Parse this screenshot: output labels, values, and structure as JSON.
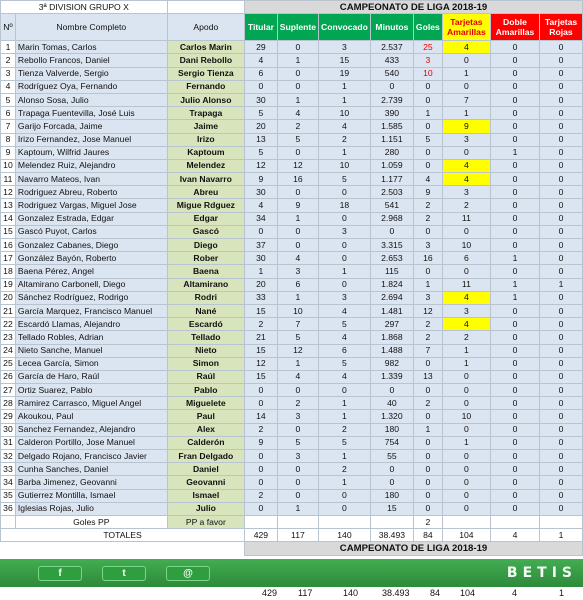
{
  "header": {
    "division": "3ª DIVISION  GRUPO X",
    "campeonato": "CAMPEONATO  DE LIGA 2018-19",
    "col_n": "Nº",
    "col_nombre": "Nombre Completo",
    "col_apodo": "Apodo",
    "col_titular": "Titular",
    "col_suplente": "Suplente",
    "col_convocado": "Convocado",
    "col_minutos": "Minutos",
    "col_goles": "Goles",
    "col_amarillas": "Tarjetas Amarillas",
    "col_doble": "Doble Amarillas",
    "col_rojas": "Tarjetas Rojas"
  },
  "players": [
    {
      "n": "1",
      "nombre": "Marin Tomas, Carlos",
      "apodo": "Carlos Marin",
      "titular": "29",
      "suplente": "0",
      "convocado": "3",
      "minutos": "2.537",
      "goles": "25",
      "amarillas": "4",
      "doble": "0",
      "rojas": "0"
    },
    {
      "n": "2",
      "nombre": "Rebollo Francos, Daniel",
      "apodo": "Dani Rebollo",
      "titular": "4",
      "suplente": "1",
      "convocado": "15",
      "minutos": "433",
      "goles": "3",
      "amarillas": "0",
      "doble": "0",
      "rojas": "0"
    },
    {
      "n": "3",
      "nombre": "Tienza Valverde, Sergio",
      "apodo": "Sergio Tienza",
      "titular": "6",
      "suplente": "0",
      "convocado": "19",
      "minutos": "540",
      "goles": "10",
      "amarillas": "1",
      "doble": "0",
      "rojas": "0"
    },
    {
      "n": "4",
      "nombre": "Rodríguez Oya, Fernando",
      "apodo": "Fernando",
      "titular": "0",
      "suplente": "0",
      "convocado": "1",
      "minutos": "0",
      "goles": "0",
      "amarillas": "0",
      "doble": "0",
      "rojas": "0"
    },
    {
      "n": "5",
      "nombre": "Alonso Sosa, Julio",
      "apodo": "Julio Alonso",
      "titular": "30",
      "suplente": "1",
      "convocado": "1",
      "minutos": "2.739",
      "goles": "0",
      "amarillas": "7",
      "doble": "0",
      "rojas": "0"
    },
    {
      "n": "6",
      "nombre": "Trapaga Fuentevilla, José Luis",
      "apodo": "Trapaga",
      "titular": "5",
      "suplente": "4",
      "convocado": "10",
      "minutos": "390",
      "goles": "1",
      "amarillas": "1",
      "doble": "0",
      "rojas": "0"
    },
    {
      "n": "7",
      "nombre": "Garijo Forcada, Jaime",
      "apodo": "Jaime",
      "titular": "20",
      "suplente": "2",
      "convocado": "4",
      "minutos": "1.585",
      "goles": "0",
      "amarillas": "9",
      "doble": "0",
      "rojas": "0"
    },
    {
      "n": "8",
      "nombre": "Irizo Fernandez, Jose Manuel",
      "apodo": "Irizo",
      "titular": "13",
      "suplente": "5",
      "convocado": "2",
      "minutos": "1.151",
      "goles": "5",
      "amarillas": "3",
      "doble": "0",
      "rojas": "0"
    },
    {
      "n": "9",
      "nombre": "Kaptoum, Wilfrid Jaures",
      "apodo": "Kaptoum",
      "titular": "5",
      "suplente": "0",
      "convocado": "1",
      "minutos": "280",
      "goles": "0",
      "amarillas": "0",
      "doble": "1",
      "rojas": "0"
    },
    {
      "n": "10",
      "nombre": "Melendez Ruiz, Alejandro",
      "apodo": "Melendez",
      "titular": "12",
      "suplente": "12",
      "convocado": "10",
      "minutos": "1.059",
      "goles": "0",
      "amarillas": "4",
      "doble": "0",
      "rojas": "0"
    },
    {
      "n": "11",
      "nombre": "Navarro Mateos, Ivan",
      "apodo": "Ivan Navarro",
      "titular": "9",
      "suplente": "16",
      "convocado": "5",
      "minutos": "1.177",
      "goles": "4",
      "amarillas": "4",
      "doble": "0",
      "rojas": "0"
    },
    {
      "n": "12",
      "nombre": "Rodriguez Abreu, Roberto",
      "apodo": "Abreu",
      "titular": "30",
      "suplente": "0",
      "convocado": "0",
      "minutos": "2.503",
      "goles": "9",
      "amarillas": "3",
      "doble": "0",
      "rojas": "0"
    },
    {
      "n": "13",
      "nombre": "Rodriguez Vargas, Miguel Jose",
      "apodo": "Migue Rdguez",
      "titular": "4",
      "suplente": "9",
      "convocado": "18",
      "minutos": "541",
      "goles": "2",
      "amarillas": "2",
      "doble": "0",
      "rojas": "0"
    },
    {
      "n": "14",
      "nombre": "Gonzalez Estrada, Edgar",
      "apodo": "Edgar",
      "titular": "34",
      "suplente": "1",
      "convocado": "0",
      "minutos": "2.968",
      "goles": "2",
      "amarillas": "11",
      "doble": "0",
      "rojas": "0"
    },
    {
      "n": "15",
      "nombre": "Gascó Puyot, Carlos",
      "apodo": "Gascó",
      "titular": "0",
      "suplente": "0",
      "convocado": "3",
      "minutos": "0",
      "goles": "0",
      "amarillas": "0",
      "doble": "0",
      "rojas": "0"
    },
    {
      "n": "16",
      "nombre": "Gonzalez Cabanes, Diego",
      "apodo": "Diego",
      "titular": "37",
      "suplente": "0",
      "convocado": "0",
      "minutos": "3.315",
      "goles": "3",
      "amarillas": "10",
      "doble": "0",
      "rojas": "0"
    },
    {
      "n": "17",
      "nombre": "González Bayón, Roberto",
      "apodo": "Rober",
      "titular": "30",
      "suplente": "4",
      "convocado": "0",
      "minutos": "2.653",
      "goles": "16",
      "amarillas": "6",
      "doble": "1",
      "rojas": "0"
    },
    {
      "n": "18",
      "nombre": "Baena Pérez, Angel",
      "apodo": "Baena",
      "titular": "1",
      "suplente": "3",
      "convocado": "1",
      "minutos": "115",
      "goles": "0",
      "amarillas": "0",
      "doble": "0",
      "rojas": "0"
    },
    {
      "n": "19",
      "nombre": "Altamirano Carbonell, Diego",
      "apodo": "Altamirano",
      "titular": "20",
      "suplente": "6",
      "convocado": "0",
      "minutos": "1.824",
      "goles": "1",
      "amarillas": "11",
      "doble": "1",
      "rojas": "1"
    },
    {
      "n": "20",
      "nombre": "Sánchez Rodríguez, Rodrigo",
      "apodo": "Rodri",
      "titular": "33",
      "suplente": "1",
      "convocado": "3",
      "minutos": "2.694",
      "goles": "3",
      "amarillas": "4",
      "doble": "1",
      "rojas": "0"
    },
    {
      "n": "21",
      "nombre": "García Marquez, Francisco Manuel",
      "apodo": "Nané",
      "titular": "15",
      "suplente": "10",
      "convocado": "4",
      "minutos": "1.481",
      "goles": "12",
      "amarillas": "3",
      "doble": "0",
      "rojas": "0"
    },
    {
      "n": "22",
      "nombre": "Escardó Llamas, Alejandro",
      "apodo": "Escardó",
      "titular": "2",
      "suplente": "7",
      "convocado": "5",
      "minutos": "297",
      "goles": "2",
      "amarillas": "4",
      "doble": "0",
      "rojas": "0"
    },
    {
      "n": "23",
      "nombre": "Tellado Robles, Adrian",
      "apodo": "Tellado",
      "titular": "21",
      "suplente": "5",
      "convocado": "4",
      "minutos": "1.868",
      "goles": "2",
      "amarillas": "2",
      "doble": "0",
      "rojas": "0"
    },
    {
      "n": "24",
      "nombre": "Nieto Sanche, Manuel",
      "apodo": "Nieto",
      "titular": "15",
      "suplente": "12",
      "convocado": "6",
      "minutos": "1.488",
      "goles": "7",
      "amarillas": "1",
      "doble": "0",
      "rojas": "0"
    },
    {
      "n": "25",
      "nombre": "Lecea García, Simon",
      "apodo": "Simon",
      "titular": "12",
      "suplente": "1",
      "convocado": "5",
      "minutos": "982",
      "goles": "0",
      "amarillas": "1",
      "doble": "0",
      "rojas": "0"
    },
    {
      "n": "26",
      "nombre": "García de Haro, Raúl",
      "apodo": "Raúl",
      "titular": "15",
      "suplente": "4",
      "convocado": "4",
      "minutos": "1.339",
      "goles": "13",
      "amarillas": "0",
      "doble": "0",
      "rojas": "0"
    },
    {
      "n": "27",
      "nombre": "Ortiz Suarez, Pablo",
      "apodo": "Pablo",
      "titular": "0",
      "suplente": "0",
      "convocado": "0",
      "minutos": "0",
      "goles": "0",
      "amarillas": "0",
      "doble": "0",
      "rojas": "0"
    },
    {
      "n": "28",
      "nombre": "Ramirez Carrasco, Miguel Angel",
      "apodo": "Miguelete",
      "titular": "0",
      "suplente": "2",
      "convocado": "1",
      "minutos": "40",
      "goles": "2",
      "amarillas": "0",
      "doble": "0",
      "rojas": "0"
    },
    {
      "n": "29",
      "nombre": "Akoukou, Paul",
      "apodo": "Paul",
      "titular": "14",
      "suplente": "3",
      "convocado": "1",
      "minutos": "1.320",
      "goles": "0",
      "amarillas": "10",
      "doble": "0",
      "rojas": "0"
    },
    {
      "n": "30",
      "nombre": "Sanchez Fernandez, Alejandro",
      "apodo": "Alex",
      "titular": "2",
      "suplente": "0",
      "convocado": "2",
      "minutos": "180",
      "goles": "1",
      "amarillas": "0",
      "doble": "0",
      "rojas": "0"
    },
    {
      "n": "31",
      "nombre": "Calderon Portillo, Jose Manuel",
      "apodo": "Calderón",
      "titular": "9",
      "suplente": "5",
      "convocado": "5",
      "minutos": "754",
      "goles": "0",
      "amarillas": "1",
      "doble": "0",
      "rojas": "0"
    },
    {
      "n": "32",
      "nombre": "Delgado Rojano, Francisco Javier",
      "apodo": "Fran Delgado",
      "titular": "0",
      "suplente": "3",
      "convocado": "1",
      "minutos": "55",
      "goles": "0",
      "amarillas": "0",
      "doble": "0",
      "rojas": "0"
    },
    {
      "n": "33",
      "nombre": "Cunha Sanches, Daniel",
      "apodo": "Daniel",
      "titular": "0",
      "suplente": "0",
      "convocado": "2",
      "minutos": "0",
      "goles": "0",
      "amarillas": "0",
      "doble": "0",
      "rojas": "0"
    },
    {
      "n": "34",
      "nombre": "Barba Jimenez, Geovanni",
      "apodo": "Geovanni",
      "titular": "0",
      "suplente": "0",
      "convocado": "1",
      "minutos": "0",
      "goles": "0",
      "amarillas": "0",
      "doble": "0",
      "rojas": "0"
    },
    {
      "n": "35",
      "nombre": "Gutierrez Montilla, Ismael",
      "apodo": "Ismael",
      "titular": "2",
      "suplente": "0",
      "convocado": "0",
      "minutos": "180",
      "goles": "0",
      "amarillas": "0",
      "doble": "0",
      "rojas": "0"
    },
    {
      "n": "36",
      "nombre": "Iglesias Rojas, Julio",
      "apodo": "Julio",
      "titular": "0",
      "suplente": "1",
      "convocado": "0",
      "minutos": "15",
      "goles": "0",
      "amarillas": "0",
      "doble": "0",
      "rojas": "0"
    }
  ],
  "goles_pp": {
    "label": "Goles PP",
    "apodo": "PP a favor",
    "goles": "2"
  },
  "totales": {
    "label": "TOTALES",
    "titular": "429",
    "suplente": "117",
    "convocado": "140",
    "minutos": "38.493",
    "goles": "84",
    "amarillas": "104",
    "doble": "4",
    "rojas": "1"
  },
  "footer": {
    "campeonato": "CAMPEONATO  DE LIGA 2018-19",
    "brand": "BETIS",
    "facebook": "f",
    "twitter": "t",
    "instagram": "@",
    "titular": "429",
    "suplente": "117",
    "convocado": "140",
    "minutos": "38.493",
    "goles": "84",
    "amarillas": "104",
    "doble": "4",
    "rojas": "1"
  },
  "colors": {
    "yellow_highlight": "#ffff00",
    "green_header": "#00a651",
    "red_header": "#ff0000",
    "red_text": "#e30000"
  },
  "highlights": {
    "red_goles_rows": [
      1,
      2,
      3
    ],
    "yellow_amarillas_rows": [
      1,
      7,
      10,
      11,
      20,
      22
    ]
  }
}
